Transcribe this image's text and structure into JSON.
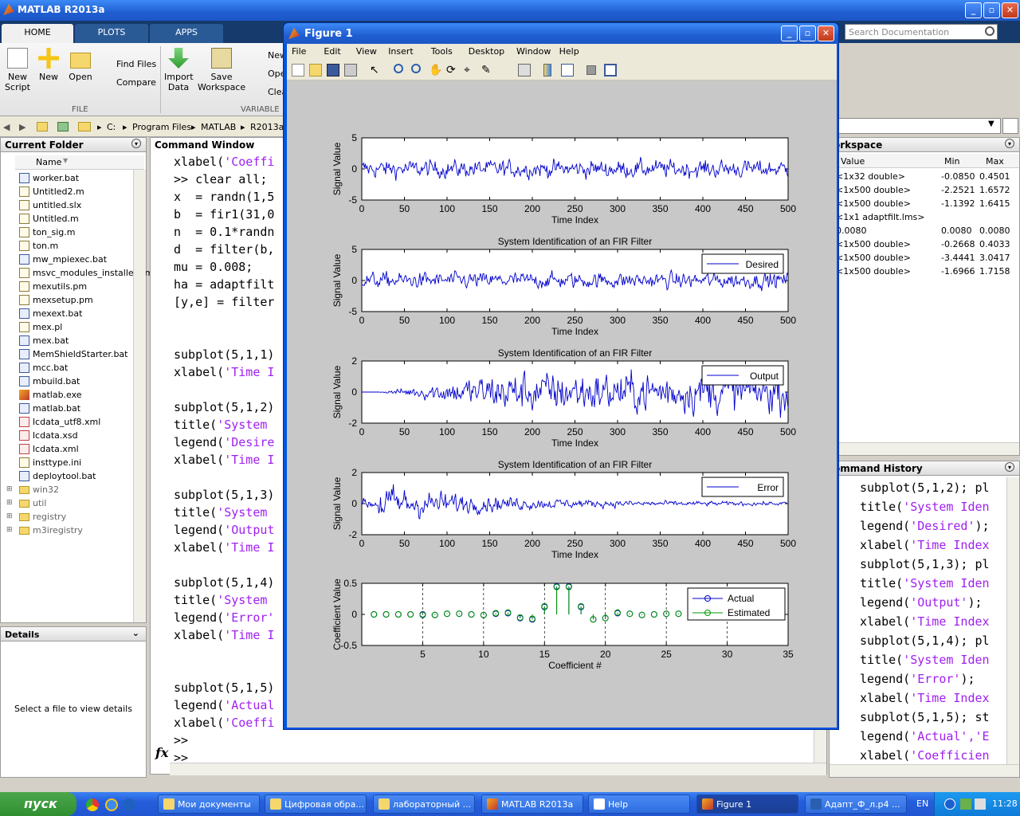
{
  "app": {
    "title": "MATLAB R2013a"
  },
  "ribbon": {
    "tabs": [
      "HOME",
      "PLOTS",
      "APPS"
    ],
    "buttons": {
      "new_script": "New\nScript",
      "new": "New",
      "open": "Open",
      "find_files": "Find Files",
      "compare": "Compare",
      "import_data": "Import\nData",
      "save_workspace": "Save\nWorkspace",
      "new_var": "New",
      "open_var": "Ope",
      "clear": "Clea"
    },
    "sections": {
      "file": "FILE",
      "variable": "VARIABLE"
    }
  },
  "search": {
    "placeholder": "Search Documentation"
  },
  "address": {
    "path": [
      "C:",
      "Program Files",
      "MATLAB",
      "R2013a"
    ]
  },
  "current_folder": {
    "title": "Current Folder",
    "column": "Name",
    "files": [
      {
        "name": "worker.bat",
        "type": "bat"
      },
      {
        "name": "Untitled2.m",
        "type": "m"
      },
      {
        "name": "untitled.slx",
        "type": "m"
      },
      {
        "name": "Untitled.m",
        "type": "m"
      },
      {
        "name": "ton_sig.m",
        "type": "m"
      },
      {
        "name": "ton.m",
        "type": "m"
      },
      {
        "name": "mw_mpiexec.bat",
        "type": "bat"
      },
      {
        "name": "msvc_modules_installer.pm",
        "type": "m"
      },
      {
        "name": "mexutils.pm",
        "type": "m"
      },
      {
        "name": "mexsetup.pm",
        "type": "m"
      },
      {
        "name": "mexext.bat",
        "type": "bat"
      },
      {
        "name": "mex.pl",
        "type": "m"
      },
      {
        "name": "mex.bat",
        "type": "bat"
      },
      {
        "name": "MemShieldStarter.bat",
        "type": "bat"
      },
      {
        "name": "mcc.bat",
        "type": "bat"
      },
      {
        "name": "mbuild.bat",
        "type": "bat"
      },
      {
        "name": "matlab.exe",
        "type": "exe"
      },
      {
        "name": "matlab.bat",
        "type": "bat"
      },
      {
        "name": "lcdata_utf8.xml",
        "type": "xml"
      },
      {
        "name": "lcdata.xsd",
        "type": "xml"
      },
      {
        "name": "lcdata.xml",
        "type": "xml"
      },
      {
        "name": "insttype.ini",
        "type": "m"
      },
      {
        "name": "deploytool.bat",
        "type": "bat"
      },
      {
        "name": "win32",
        "type": "fold"
      },
      {
        "name": "util",
        "type": "fold"
      },
      {
        "name": "registry",
        "type": "fold"
      },
      {
        "name": "m3iregistry",
        "type": "fold"
      }
    ]
  },
  "details": {
    "title": "Details",
    "empty": "Select a file to view details"
  },
  "command_window": {
    "title": "Command Window",
    "lines": [
      [
        [
          "xlabel(",
          ""
        ],
        [
          "'Coeffi",
          "s"
        ]
      ],
      [
        [
          ">> clear ",
          ""
        ],
        [
          "all",
          ""
        ],
        [
          ";",
          ""
        ]
      ],
      [
        [
          "x  = randn(1,5",
          ""
        ]
      ],
      [
        [
          "b  = fir1(31,0",
          ""
        ]
      ],
      [
        [
          "n  = 0.1*randn",
          ""
        ]
      ],
      [
        [
          "d  = filter(b,",
          ""
        ]
      ],
      [
        [
          "mu = 0.008;",
          ""
        ]
      ],
      [
        [
          "ha = adaptfilt",
          ""
        ]
      ],
      [
        [
          "[y,e] = filter",
          ""
        ]
      ],
      [
        [
          "",
          ""
        ]
      ],
      [
        [
          "",
          ""
        ]
      ],
      [
        [
          "subplot(5,1,1)",
          ""
        ]
      ],
      [
        [
          "xlabel(",
          ""
        ],
        [
          "'Time I",
          "s"
        ]
      ],
      [
        [
          "",
          ""
        ]
      ],
      [
        [
          "subplot(5,1,2)",
          ""
        ]
      ],
      [
        [
          "title(",
          ""
        ],
        [
          "'System ",
          "s"
        ]
      ],
      [
        [
          "legend(",
          ""
        ],
        [
          "'Desire",
          "s"
        ]
      ],
      [
        [
          "xlabel(",
          ""
        ],
        [
          "'Time I",
          "s"
        ]
      ],
      [
        [
          "",
          ""
        ]
      ],
      [
        [
          "subplot(5,1,3)",
          ""
        ]
      ],
      [
        [
          "title(",
          ""
        ],
        [
          "'System ",
          "s"
        ]
      ],
      [
        [
          "legend(",
          ""
        ],
        [
          "'Output",
          "s"
        ]
      ],
      [
        [
          "xlabel(",
          ""
        ],
        [
          "'Time I",
          "s"
        ]
      ],
      [
        [
          "",
          ""
        ]
      ],
      [
        [
          "subplot(5,1,4)",
          ""
        ]
      ],
      [
        [
          "title(",
          ""
        ],
        [
          "'System ",
          "s"
        ]
      ],
      [
        [
          "legend(",
          ""
        ],
        [
          "'Error'",
          "s"
        ]
      ],
      [
        [
          "xlabel(",
          ""
        ],
        [
          "'Time I",
          "s"
        ]
      ],
      [
        [
          "",
          ""
        ]
      ],
      [
        [
          "",
          ""
        ]
      ],
      [
        [
          "subplot(5,1,5)",
          ""
        ]
      ],
      [
        [
          "legend(",
          ""
        ],
        [
          "'Actual",
          "s"
        ]
      ],
      [
        [
          "xlabel(",
          ""
        ],
        [
          "'Coeffi",
          "s"
        ]
      ],
      [
        [
          ">>",
          ""
        ]
      ],
      [
        [
          ">>",
          ""
        ]
      ]
    ],
    "prompt_icon": "fx"
  },
  "workspace": {
    "title": "orkspace",
    "columns": [
      "Value",
      "Min",
      "Max"
    ],
    "rows": [
      [
        "<1x32 double>",
        "-0.0850",
        "0.4501"
      ],
      [
        "<1x500 double>",
        "-2.2521",
        "1.6572"
      ],
      [
        "<1x500 double>",
        "-1.1392",
        "1.6415"
      ],
      [
        "<1x1 adaptfilt.lms>",
        "",
        ""
      ],
      [
        "0.0080",
        "0.0080",
        "0.0080"
      ],
      [
        "<1x500 double>",
        "-0.2668",
        "0.4033"
      ],
      [
        "<1x500 double>",
        "-3.4441",
        "3.0417"
      ],
      [
        "<1x500 double>",
        "-1.6966",
        "1.7158"
      ]
    ]
  },
  "history": {
    "title": "ommand History",
    "lines": [
      [
        [
          "subplot(5,1,2); pl",
          ""
        ]
      ],
      [
        [
          "title(",
          ""
        ],
        [
          "'System Iden",
          "s"
        ]
      ],
      [
        [
          "legend(",
          ""
        ],
        [
          "'Desired'",
          "s"
        ],
        [
          ");",
          ""
        ]
      ],
      [
        [
          "xlabel(",
          ""
        ],
        [
          "'Time Index",
          "s"
        ]
      ],
      [
        [
          "subplot(5,1,3); pl",
          ""
        ]
      ],
      [
        [
          "title(",
          ""
        ],
        [
          "'System Iden",
          "s"
        ]
      ],
      [
        [
          "legend(",
          ""
        ],
        [
          "'Output'",
          "s"
        ],
        [
          ");",
          ""
        ]
      ],
      [
        [
          "xlabel(",
          ""
        ],
        [
          "'Time Index",
          "s"
        ]
      ],
      [
        [
          "subplot(5,1,4); pl",
          ""
        ]
      ],
      [
        [
          "title(",
          ""
        ],
        [
          "'System Iden",
          "s"
        ]
      ],
      [
        [
          "legend(",
          ""
        ],
        [
          "'Error'",
          "s"
        ],
        [
          ");",
          ""
        ]
      ],
      [
        [
          "xlabel(",
          ""
        ],
        [
          "'Time Index",
          "s"
        ]
      ],
      [
        [
          "subplot(5,1,5); st",
          ""
        ]
      ],
      [
        [
          "legend(",
          ""
        ],
        [
          "'Actual','E",
          "s"
        ]
      ],
      [
        [
          "xlabel(",
          ""
        ],
        [
          "'Coefficien",
          "s"
        ]
      ]
    ]
  },
  "figure": {
    "title": "Figure 1",
    "menu": [
      "File",
      "Edit",
      "View",
      "Insert",
      "Tools",
      "Desktop",
      "Window",
      "Help"
    ]
  },
  "chart_data": [
    {
      "type": "line",
      "title": "",
      "xlabel": "Time Index",
      "ylabel": "Signal Value",
      "xlim": [
        0,
        500
      ],
      "ylim": [
        -5,
        5
      ],
      "xticks": [
        0,
        50,
        100,
        150,
        200,
        250,
        300,
        350,
        400,
        450,
        500
      ],
      "yticks": [
        -5,
        0,
        5
      ],
      "series": [
        {
          "amplitude": 1.0,
          "envelope": "constant",
          "color": "#0000cc"
        }
      ]
    },
    {
      "type": "line",
      "title": "System Identification of an FIR Filter",
      "xlabel": "Time Index",
      "ylabel": "Signal Value",
      "xlim": [
        0,
        500
      ],
      "ylim": [
        -5,
        5
      ],
      "xticks": [
        0,
        50,
        100,
        150,
        200,
        250,
        300,
        350,
        400,
        450,
        500
      ],
      "yticks": [
        -5,
        0,
        5
      ],
      "legend": "top-right",
      "series": [
        {
          "name": "Desired",
          "amplitude": 0.9,
          "envelope": "constant",
          "color": "#0000cc"
        }
      ]
    },
    {
      "type": "line",
      "title": "System Identification of an FIR Filter",
      "xlabel": "Time Index",
      "ylabel": "Signal Value",
      "xlim": [
        0,
        500
      ],
      "ylim": [
        -2,
        2
      ],
      "xticks": [
        0,
        50,
        100,
        150,
        200,
        250,
        300,
        350,
        400,
        450,
        500
      ],
      "yticks": [
        -2,
        0,
        2
      ],
      "legend": "top-right",
      "series": [
        {
          "name": "Output",
          "amplitude": 0.9,
          "envelope": "growing",
          "color": "#0000cc"
        }
      ]
    },
    {
      "type": "line",
      "title": "System Identification of an FIR Filter",
      "xlabel": "Time Index",
      "ylabel": "Signal Value",
      "xlim": [
        0,
        500
      ],
      "ylim": [
        -2,
        2
      ],
      "xticks": [
        0,
        50,
        100,
        150,
        200,
        250,
        300,
        350,
        400,
        450,
        500
      ],
      "yticks": [
        -2,
        0,
        2
      ],
      "legend": "top-right",
      "series": [
        {
          "name": "Error",
          "amplitude": 0.6,
          "envelope": "decaying",
          "color": "#0000cc"
        }
      ]
    },
    {
      "type": "scatter",
      "title": "",
      "xlabel": "Coefficient #",
      "ylabel": "Coefficient Value",
      "xlim": [
        0,
        35
      ],
      "ylim": [
        -0.5,
        0.5
      ],
      "xticks": [
        5,
        10,
        15,
        20,
        25,
        30,
        35
      ],
      "yticks": [
        -0.5,
        0,
        0.5
      ],
      "legend": "top-right",
      "x": [
        1,
        2,
        3,
        4,
        5,
        6,
        7,
        8,
        9,
        10,
        11,
        12,
        13,
        14,
        15,
        16,
        17,
        18,
        19,
        20,
        21,
        22,
        23,
        24,
        25,
        26,
        27,
        28,
        29,
        30,
        31,
        32
      ],
      "series": [
        {
          "name": "Actual",
          "color": "#0000cc",
          "values": [
            0,
            0,
            0,
            0,
            0,
            -0.01,
            0.01,
            0.01,
            0,
            -0.01,
            0.01,
            0.02,
            -0.06,
            -0.08,
            0.12,
            0.45,
            0.45,
            0.12,
            -0.08,
            -0.06,
            0.02,
            0.01,
            -0.01,
            0,
            0.01,
            0.01,
            -0.01,
            0,
            0,
            0,
            0,
            0
          ]
        },
        {
          "name": "Estimated",
          "color": "#009900",
          "values": [
            0,
            0,
            0,
            0,
            -0.01,
            -0.01,
            0.01,
            0.01,
            0,
            -0.01,
            0.02,
            0.03,
            -0.05,
            -0.07,
            0.13,
            0.44,
            0.44,
            0.13,
            -0.08,
            -0.06,
            0.03,
            0.01,
            -0.01,
            0,
            0.01,
            0.01,
            -0.01,
            0,
            0,
            0,
            0,
            0
          ]
        }
      ]
    }
  ],
  "taskbar": {
    "start": "пуск",
    "tasks": [
      "Мои документы",
      "Цифровая обра...",
      "лабораторный ...",
      "MATLAB R2013a",
      "Help",
      "Figure 1",
      "Адапт_Ф_л.р4 ..."
    ],
    "lang": "EN",
    "time": "11:28"
  }
}
